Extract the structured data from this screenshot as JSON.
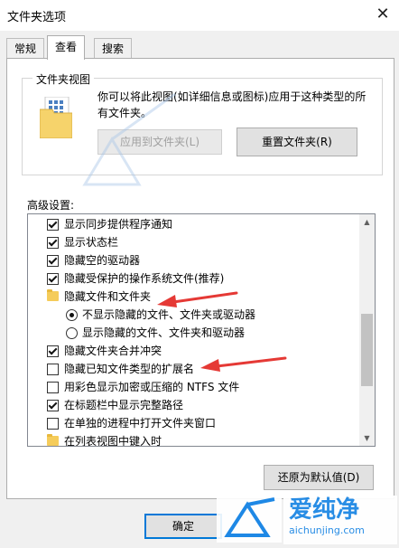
{
  "window": {
    "title": "文件夹选项"
  },
  "tabs": [
    {
      "label": "常规"
    },
    {
      "label": "查看"
    },
    {
      "label": "搜索"
    }
  ],
  "folder_view": {
    "legend": "文件夹视图",
    "description": "你可以将此视图(如详细信息或图标)应用于这种类型的所有文件夹。",
    "apply_button": "应用到文件夹(L)",
    "reset_button": "重置文件夹(R)"
  },
  "advanced": {
    "label": "高级设置:",
    "items": [
      {
        "type": "checkbox",
        "checked": true,
        "label": "显示同步提供程序通知"
      },
      {
        "type": "checkbox",
        "checked": true,
        "label": "显示状态栏"
      },
      {
        "type": "checkbox",
        "checked": true,
        "label": "隐藏空的驱动器"
      },
      {
        "type": "checkbox",
        "checked": true,
        "label": "隐藏受保护的操作系统文件(推荐)"
      },
      {
        "type": "folder",
        "label": "隐藏文件和文件夹"
      },
      {
        "type": "radio",
        "checked": true,
        "label": "不显示隐藏的文件、文件夹或驱动器"
      },
      {
        "type": "radio",
        "checked": false,
        "label": "显示隐藏的文件、文件夹和驱动器"
      },
      {
        "type": "checkbox",
        "checked": true,
        "label": "隐藏文件夹合并冲突"
      },
      {
        "type": "checkbox",
        "checked": false,
        "label": "隐藏已知文件类型的扩展名"
      },
      {
        "type": "checkbox",
        "checked": false,
        "label": "用彩色显示加密或压缩的 NTFS 文件"
      },
      {
        "type": "checkbox",
        "checked": true,
        "label": "在标题栏中显示完整路径"
      },
      {
        "type": "checkbox",
        "checked": false,
        "label": "在单独的进程中打开文件夹窗口"
      },
      {
        "type": "folder",
        "label": "在列表视图中键入时"
      }
    ],
    "restore_button": "还原为默认值(D)"
  },
  "footer": {
    "ok_button": "确定"
  },
  "watermark": {
    "brand": "爱纯净",
    "url": "aichunjing.com"
  },
  "colors": {
    "annotation_arrow": "#e53935",
    "watermark": "#1e88e5",
    "focus": "#0078d7"
  }
}
